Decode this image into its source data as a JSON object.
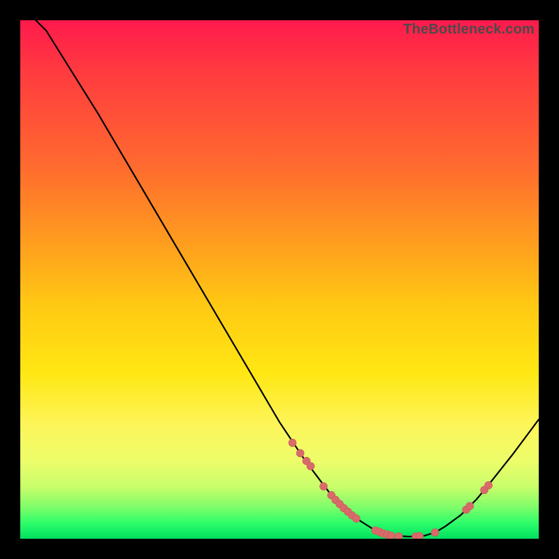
{
  "watermark": "TheBottleneck.com",
  "colors": {
    "curve_stroke": "#000000",
    "marker_fill": "#d86a6a",
    "marker_stroke": "#c85a5a",
    "background": "#000000"
  },
  "chart_data": {
    "type": "line",
    "title": "",
    "xlabel": "",
    "ylabel": "",
    "xlim": [
      0,
      100
    ],
    "ylim": [
      0,
      100
    ],
    "x": [
      0,
      5,
      10,
      15,
      20,
      25,
      30,
      35,
      40,
      45,
      50,
      55,
      60,
      62,
      65,
      68,
      70,
      72,
      75,
      78,
      80,
      82,
      85,
      88,
      90,
      95,
      100
    ],
    "values": [
      103,
      98,
      90,
      82,
      73.5,
      65,
      56.5,
      48,
      39.5,
      31,
      22.5,
      15,
      8.4,
      6.3,
      3.8,
      1.9,
      1.1,
      0.6,
      0.4,
      0.6,
      1.2,
      2.4,
      4.6,
      7.6,
      10,
      16.3,
      23
    ],
    "markers": [
      {
        "x": 52.5,
        "y": 18.5
      },
      {
        "x": 54.0,
        "y": 16.5
      },
      {
        "x": 55.2,
        "y": 15.0
      },
      {
        "x": 56.0,
        "y": 14.0
      },
      {
        "x": 58.5,
        "y": 10.1
      },
      {
        "x": 60.0,
        "y": 8.4
      },
      {
        "x": 60.8,
        "y": 7.5
      },
      {
        "x": 61.6,
        "y": 6.7
      },
      {
        "x": 62.4,
        "y": 5.9
      },
      {
        "x": 63.2,
        "y": 5.2
      },
      {
        "x": 64.0,
        "y": 4.5
      },
      {
        "x": 64.8,
        "y": 3.9
      },
      {
        "x": 68.5,
        "y": 1.6
      },
      {
        "x": 69.3,
        "y": 1.3
      },
      {
        "x": 70.0,
        "y": 1.0
      },
      {
        "x": 70.8,
        "y": 0.8
      },
      {
        "x": 71.5,
        "y": 0.6
      },
      {
        "x": 73.0,
        "y": 0.45
      },
      {
        "x": 76.3,
        "y": 0.45
      },
      {
        "x": 77.0,
        "y": 0.5
      },
      {
        "x": 80.0,
        "y": 1.2
      },
      {
        "x": 86.0,
        "y": 5.6
      },
      {
        "x": 86.7,
        "y": 6.3
      },
      {
        "x": 89.5,
        "y": 9.4
      },
      {
        "x": 90.3,
        "y": 10.3
      }
    ]
  }
}
